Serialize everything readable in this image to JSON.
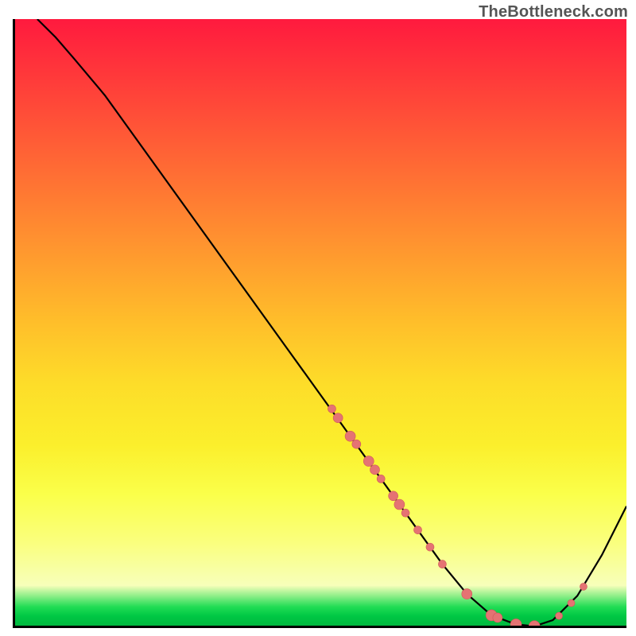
{
  "watermark": "TheBottleneck.com",
  "chart_data": {
    "type": "line",
    "title": "",
    "xlabel": "",
    "ylabel": "",
    "xlim": [
      0,
      100
    ],
    "ylim": [
      0,
      100
    ],
    "grid": false,
    "legend": false,
    "series": [
      {
        "name": "bottleneck-curve",
        "x": [
          4,
          7,
          10,
          15,
          20,
          25,
          30,
          35,
          40,
          45,
          50,
          55,
          60,
          65,
          70,
          74,
          78,
          82,
          85,
          88,
          92,
          96,
          100
        ],
        "y": [
          100,
          97,
          93.5,
          87.5,
          80.5,
          73.5,
          66.5,
          59.5,
          52.5,
          45.5,
          38.5,
          31.5,
          24.5,
          17.5,
          10.5,
          5.6,
          2.1,
          0.6,
          0.3,
          1.3,
          5.3,
          12,
          20
        ]
      }
    ],
    "markers": [
      {
        "x": 52,
        "y": 36,
        "r": 5.0
      },
      {
        "x": 53,
        "y": 34.5,
        "r": 6.0
      },
      {
        "x": 55,
        "y": 31.5,
        "r": 6.5
      },
      {
        "x": 56,
        "y": 30.2,
        "r": 5.5
      },
      {
        "x": 58,
        "y": 27.4,
        "r": 6.5
      },
      {
        "x": 59,
        "y": 26.0,
        "r": 6.0
      },
      {
        "x": 60,
        "y": 24.5,
        "r": 5.0
      },
      {
        "x": 62,
        "y": 21.7,
        "r": 6.0
      },
      {
        "x": 63,
        "y": 20.3,
        "r": 6.5
      },
      {
        "x": 64,
        "y": 18.9,
        "r": 5.0
      },
      {
        "x": 66,
        "y": 16.1,
        "r": 5.0
      },
      {
        "x": 68,
        "y": 13.3,
        "r": 5.0
      },
      {
        "x": 70,
        "y": 10.5,
        "r": 5.0
      },
      {
        "x": 74,
        "y": 5.6,
        "r": 6.5
      },
      {
        "x": 78,
        "y": 2.1,
        "r": 7.0
      },
      {
        "x": 79,
        "y": 1.7,
        "r": 6.0
      },
      {
        "x": 82,
        "y": 0.6,
        "r": 7.0
      },
      {
        "x": 85,
        "y": 0.3,
        "r": 7.0
      },
      {
        "x": 89,
        "y": 2.0,
        "r": 4.5
      },
      {
        "x": 91,
        "y": 4.1,
        "r": 4.5
      },
      {
        "x": 93,
        "y": 6.8,
        "r": 4.5
      }
    ],
    "colors": {
      "curve": "#000000",
      "marker_fill": "#e57373",
      "marker_stroke": "#d15a5a"
    }
  }
}
